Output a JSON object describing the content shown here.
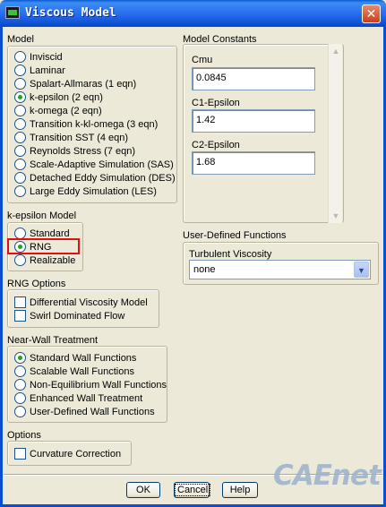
{
  "window": {
    "title": "Viscous Model",
    "close_glyph": "✕"
  },
  "model": {
    "label": "Model",
    "options": [
      {
        "label": "Inviscid",
        "selected": false
      },
      {
        "label": "Laminar",
        "selected": false
      },
      {
        "label": "Spalart-Allmaras (1 eqn)",
        "selected": false
      },
      {
        "label": "k-epsilon (2 eqn)",
        "selected": true
      },
      {
        "label": "k-omega (2 eqn)",
        "selected": false
      },
      {
        "label": "Transition k-kl-omega (3 eqn)",
        "selected": false
      },
      {
        "label": "Transition SST (4 eqn)",
        "selected": false
      },
      {
        "label": "Reynolds Stress (7 eqn)",
        "selected": false
      },
      {
        "label": "Scale-Adaptive Simulation (SAS)",
        "selected": false
      },
      {
        "label": "Detached Eddy Simulation (DES)",
        "selected": false
      },
      {
        "label": "Large Eddy Simulation (LES)",
        "selected": false
      }
    ]
  },
  "kepsilon_model": {
    "label": "k-epsilon Model",
    "options": [
      {
        "label": "Standard",
        "selected": false
      },
      {
        "label": "RNG",
        "selected": true
      },
      {
        "label": "Realizable",
        "selected": false
      }
    ]
  },
  "rng_options": {
    "label": "RNG Options",
    "options": [
      {
        "label": "Differential Viscosity Model",
        "checked": false
      },
      {
        "label": "Swirl Dominated Flow",
        "checked": false
      }
    ]
  },
  "near_wall": {
    "label": "Near-Wall Treatment",
    "options": [
      {
        "label": "Standard Wall Functions",
        "selected": true
      },
      {
        "label": "Scalable Wall Functions",
        "selected": false
      },
      {
        "label": "Non-Equilibrium Wall Functions",
        "selected": false
      },
      {
        "label": "Enhanced Wall Treatment",
        "selected": false
      },
      {
        "label": "User-Defined Wall Functions",
        "selected": false
      }
    ]
  },
  "options": {
    "label": "Options",
    "items": [
      {
        "label": "Curvature Correction",
        "checked": false
      }
    ]
  },
  "model_constants": {
    "label": "Model Constants",
    "fields": [
      {
        "label": "Cmu",
        "value": "0.0845"
      },
      {
        "label": "C1-Epsilon",
        "value": "1.42"
      },
      {
        "label": "C2-Epsilon",
        "value": "1.68"
      }
    ]
  },
  "udf": {
    "label": "User-Defined Functions",
    "turbulent_viscosity_label": "Turbulent Viscosity",
    "turbulent_viscosity_value": "none"
  },
  "buttons": {
    "ok": "OK",
    "cancel": "Cancel",
    "help": "Help"
  },
  "watermark": "CAEnet",
  "colors": {
    "titlebar": "#0a58d0",
    "highlight": "#e01010",
    "radio_selected": "#21a121"
  }
}
